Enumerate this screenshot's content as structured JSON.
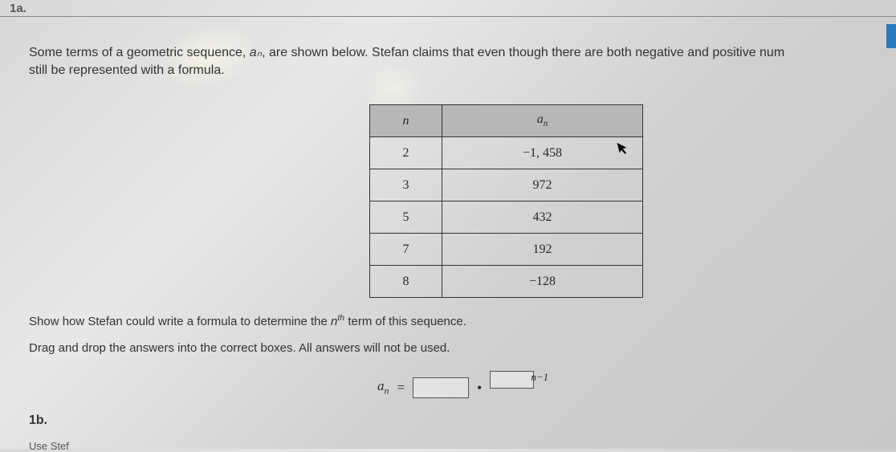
{
  "labels": {
    "q1a": "1a.",
    "q1b": "1b.",
    "cut": "Use Stef"
  },
  "prompt": {
    "line1_a": "Some terms of a geometric sequence, ",
    "line1_an": "aₙ",
    "line1_b": ", are shown below. Stefan claims that even though there are both negative and positive num",
    "line2": "still be represented with a formula."
  },
  "table": {
    "head_n": "n",
    "head_an_base": "a",
    "head_an_sub": "n",
    "rows": [
      {
        "n": "2",
        "an": "−1, 458"
      },
      {
        "n": "3",
        "an": "972"
      },
      {
        "n": "5",
        "an": "432"
      },
      {
        "n": "7",
        "an": "192"
      },
      {
        "n": "8",
        "an": "−128"
      }
    ]
  },
  "instructions": {
    "line1_a": "Show how Stefan could write a formula to determine the ",
    "line1_n": "n",
    "line1_th": "th",
    "line1_b": " term of this sequence.",
    "line2": "Drag and drop the answers into the correct boxes. All answers will not be used."
  },
  "formula": {
    "lhs_base": "a",
    "lhs_sub": "n",
    "equals": "=",
    "dot": "•",
    "exp_tail": "n−1"
  },
  "chart_data": {
    "type": "table",
    "columns": [
      "n",
      "a_n"
    ],
    "rows": [
      [
        2,
        -1458
      ],
      [
        3,
        972
      ],
      [
        5,
        432
      ],
      [
        7,
        192
      ],
      [
        8,
        -128
      ]
    ]
  }
}
